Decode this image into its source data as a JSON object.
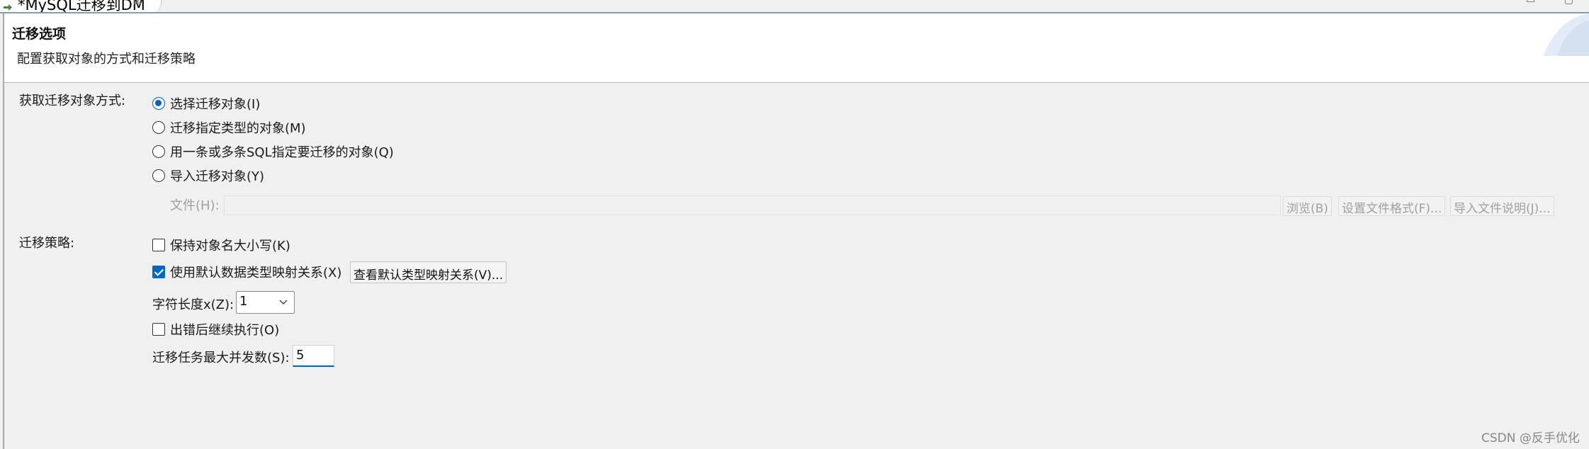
{
  "tab": {
    "title": "*MySQL迁移到DM",
    "close_glyph": "⊠",
    "window_controls": "▭ ▢"
  },
  "header": {
    "title": "迁移选项",
    "description": "配置获取对象的方式和迁移策略"
  },
  "acquire": {
    "label": "获取迁移对象方式:",
    "options": [
      {
        "label": "选择迁移对象(I)",
        "checked": true
      },
      {
        "label": "迁移指定类型的对象(M)",
        "checked": false
      },
      {
        "label": "用一条或多条SQL指定要迁移的对象(Q)",
        "checked": false
      },
      {
        "label": "导入迁移对象(Y)",
        "checked": false
      }
    ],
    "file_label": "文件(H):",
    "file_value": "",
    "browse_button": "浏览(B)",
    "format_button": "设置文件格式(F)...",
    "import_desc_button": "导入文件说明(J)..."
  },
  "strategy": {
    "label": "迁移策略:",
    "keep_case": {
      "label": "保持对象名大小写(K)",
      "checked": false
    },
    "default_mapping": {
      "label": "使用默认数据类型映射关系(X)",
      "checked": true
    },
    "view_mapping_button": "查看默认类型映射关系(V)...",
    "char_length_label": "字符长度x(Z):",
    "char_length_value": "1",
    "continue_on_error": {
      "label": "出错后继续执行(O)",
      "checked": false
    },
    "max_concurrency_label": "迁移任务最大并发数(S):",
    "max_concurrency_value": "5"
  },
  "watermark": "CSDN @反手优化",
  "colors": {
    "accent": "#0060c0",
    "background": "#f0f0f0",
    "header_bg": "#ffffff",
    "disabled_text": "#a0a0a0"
  }
}
